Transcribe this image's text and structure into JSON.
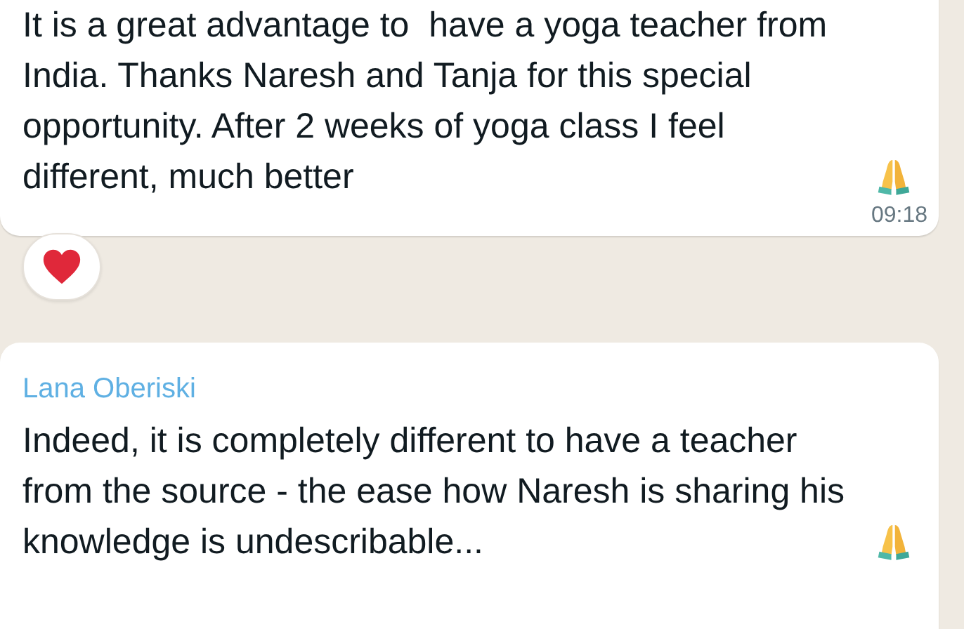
{
  "messages": [
    {
      "text": "It is a great advantage to  have a yoga teacher from India. Thanks Naresh and Tanja for this special opportunity. After 2 weeks of yoga class I feel different, much better",
      "emoji_after": true,
      "time": "09:18",
      "reaction": true
    },
    {
      "sender": "Lana Oberiski",
      "text": "Indeed, it is completely different to have a teacher from the source - the ease how Naresh is sharing his knowledge is undescribable...",
      "emoji_after": true
    }
  ]
}
